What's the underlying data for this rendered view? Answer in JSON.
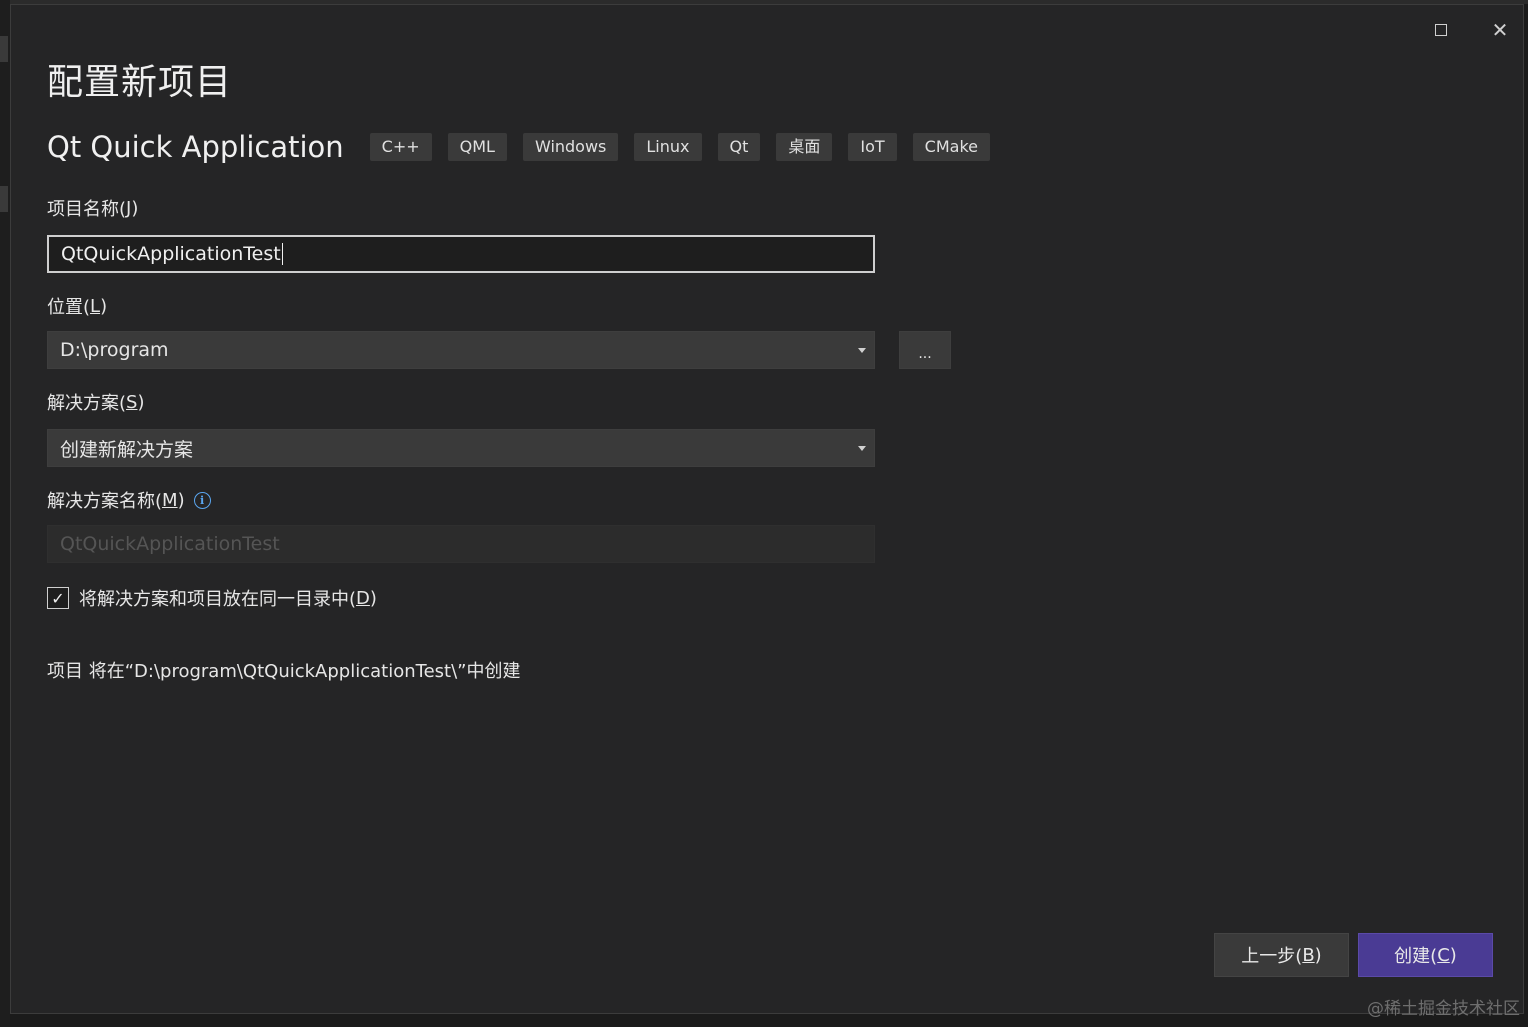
{
  "dialog": {
    "title": "配置新项目",
    "template_name": "Qt Quick Application",
    "tags": [
      "C++",
      "QML",
      "Windows",
      "Linux",
      "Qt",
      "桌面",
      "IoT",
      "CMake"
    ]
  },
  "window_controls": {
    "maximize_icon": "maximize-icon",
    "close_symbol": "✕"
  },
  "project_name": {
    "label_prefix": "项目名称(",
    "label_key": "J",
    "label_suffix": ")",
    "value": "QtQuickApplicationTest"
  },
  "location": {
    "label_prefix": "位置(",
    "label_key": "L",
    "label_suffix": ")",
    "value": "D:\\program",
    "browse_label": "..."
  },
  "solution": {
    "label_prefix": "解决方案(",
    "label_key": "S",
    "label_suffix": ")",
    "value": "创建新解决方案"
  },
  "solution_name": {
    "label_prefix": "解决方案名称(",
    "label_key": "M",
    "label_suffix": ")",
    "placeholder": "QtQuickApplicationTest",
    "info_symbol": "i"
  },
  "same_dir": {
    "checked_symbol": "✓",
    "label_prefix": "将解决方案和项目放在同一目录中(",
    "label_key": "D",
    "label_suffix": ")"
  },
  "summary": {
    "text": "项目 将在“D:\\program\\QtQuickApplicationTest\\”中创建"
  },
  "buttons": {
    "back_prefix": "上一步(",
    "back_key": "B",
    "back_suffix": ")",
    "create_prefix": "创建(",
    "create_key": "C",
    "create_suffix": ")"
  },
  "watermark": "@稀土掘金技术社区",
  "colors": {
    "window_bg": "#252526",
    "accent": "#4a3b94",
    "info": "#5aa6f0"
  }
}
